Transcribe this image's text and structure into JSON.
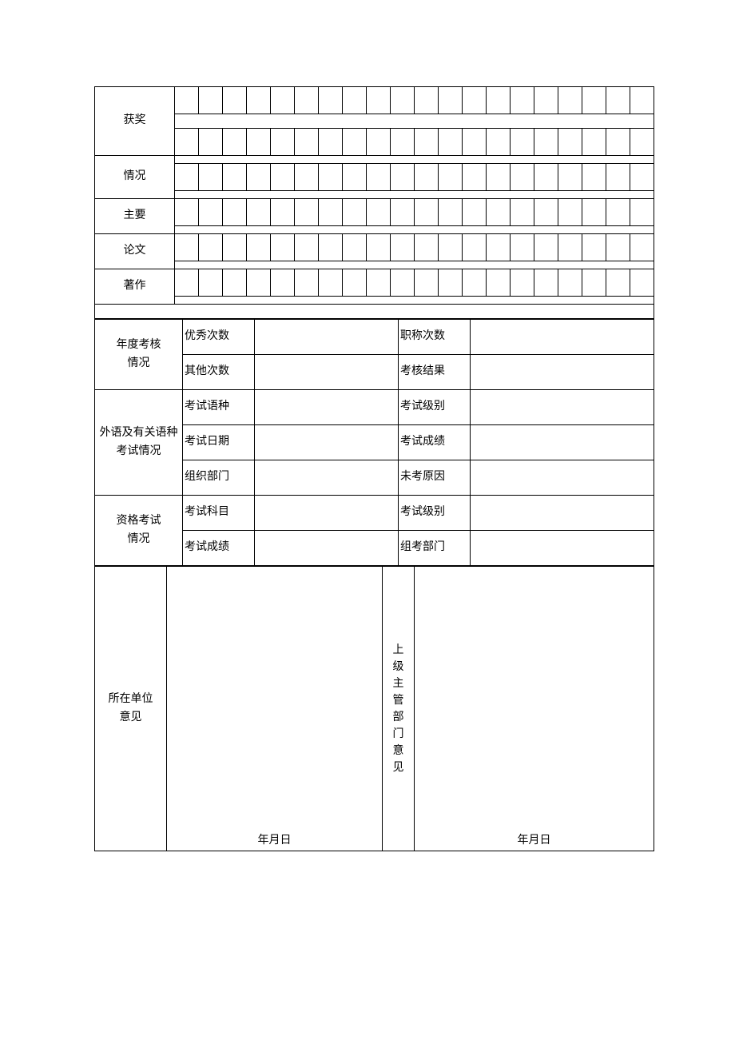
{
  "section1": {
    "label_top": "获奖",
    "label_bottom": "情况"
  },
  "section2": {
    "line1": "主要",
    "line2": "论文",
    "line3": "著作"
  },
  "assessment": {
    "label": "年度考核\n情况",
    "excellent_count_label": "优秀次数",
    "excellent_count_value": "",
    "title_count_label": "职称次数",
    "title_count_value": "",
    "other_count_label": "其他次数",
    "other_count_value": "",
    "result_label": "考核结果",
    "result_value": ""
  },
  "language": {
    "label": "外语及有关语种\n考试情况",
    "lang_label": "考试语种",
    "lang_value": "",
    "level_label": "考试级别",
    "level_value": "",
    "date_label": "考试日期",
    "date_value": "",
    "score_label": "考试成绩",
    "score_value": "",
    "org_label": "组织部门",
    "org_value": "",
    "no_exam_label": "未考原因",
    "no_exam_value": ""
  },
  "qualification": {
    "label": "资格考试\n情况",
    "subject_label": "考试科目",
    "subject_value": "",
    "level_label": "考试级别",
    "level_value": "",
    "score_label": "考试成绩",
    "score_value": "",
    "org_label": "组考部门",
    "org_value": ""
  },
  "opinions": {
    "unit_label": "所在单位\n意见",
    "unit_value": "",
    "superior_label": "上\n级\n主\n管\n部\n门\n意\n见",
    "superior_value": "",
    "date_text": "年月日"
  }
}
